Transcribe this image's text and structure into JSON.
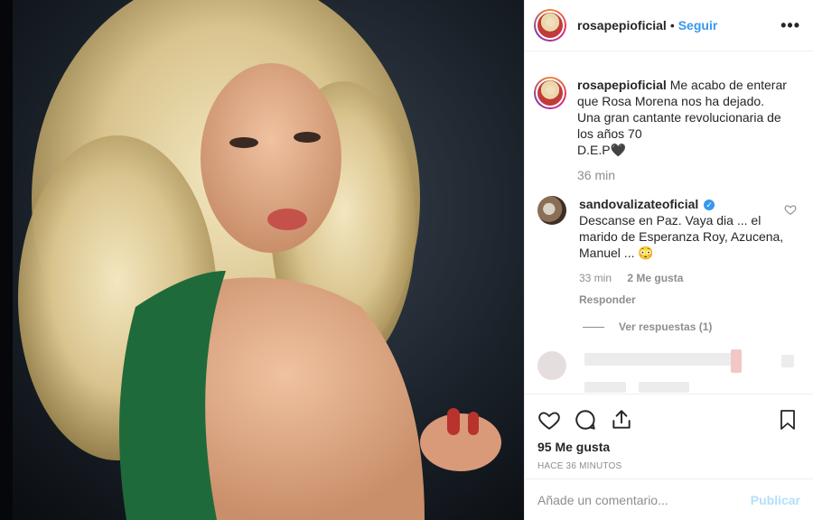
{
  "post": {
    "author": "rosapepioficial",
    "separator": "•",
    "follow_label": "Seguir",
    "more_label": "•••"
  },
  "caption": {
    "author": "rosapepioficial",
    "text_line1": "Me acabo de enterar que Rosa Morena nos ha dejado.",
    "text_line2": "Una gran cantante revolucionaria de los años 70",
    "text_line3": "D.E.P🖤",
    "time": "36 min"
  },
  "comment": {
    "author": "sandovalizateoficial",
    "verified_icon": "verified-badge-icon",
    "text": "Descanse en Paz. Vaya dia ... el marido de Esperanza Roy, Azucena, Manuel ... 😳",
    "time": "33 min",
    "likes": "2 Me gusta",
    "reply_label": "Responder",
    "view_replies": "Ver respuestas (1)"
  },
  "actions": {
    "icons": [
      "heart-icon",
      "comment-icon",
      "share-icon",
      "bookmark-icon"
    ],
    "likes": "95 Me gusta",
    "date": "HACE 36 MINUTOS"
  },
  "add_comment": {
    "placeholder": "Añade un comentario...",
    "publish_label": "Publicar"
  },
  "colors": {
    "link_blue": "#3897f0",
    "publish_disabled": "#b2dffc",
    "muted_text": "#8e8e8e"
  }
}
